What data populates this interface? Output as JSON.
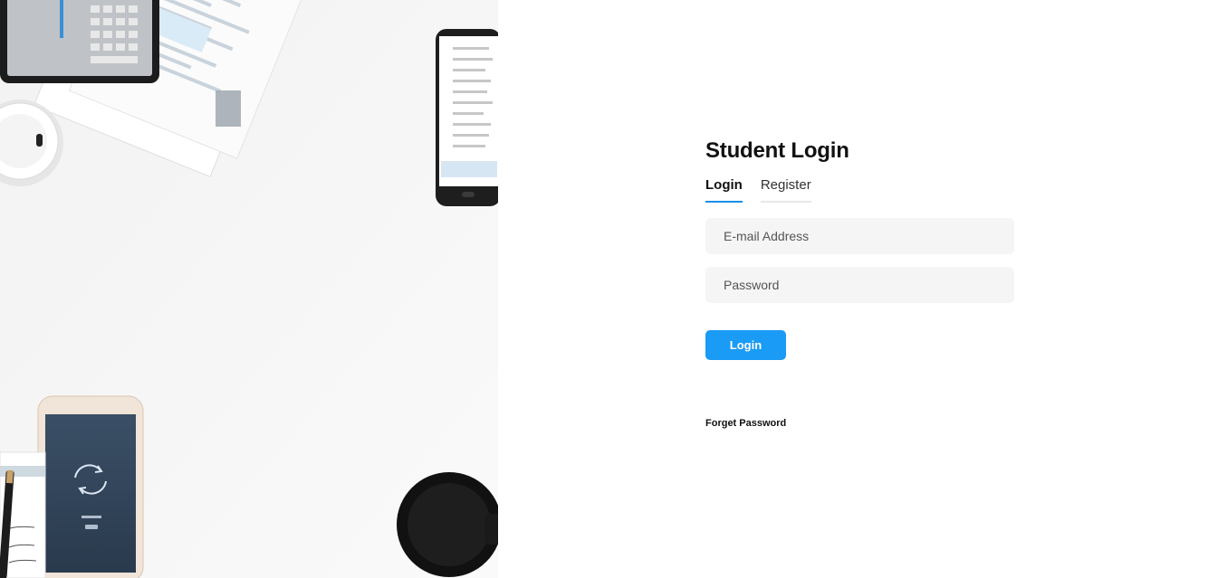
{
  "login_panel": {
    "title": "Student Login",
    "tabs": [
      {
        "label": "Login",
        "active": true
      },
      {
        "label": "Register",
        "active": false
      }
    ],
    "fields": {
      "email_placeholder": "E-mail Address",
      "password_placeholder": "Password"
    },
    "submit_label": "Login",
    "forget_password_label": "Forget Password"
  },
  "colors": {
    "accent": "#1a9bf5",
    "tab_underline_active": "#1a8fe6",
    "field_background": "#f5f5f5"
  },
  "photo": {
    "description_icon": "desk-photo"
  }
}
